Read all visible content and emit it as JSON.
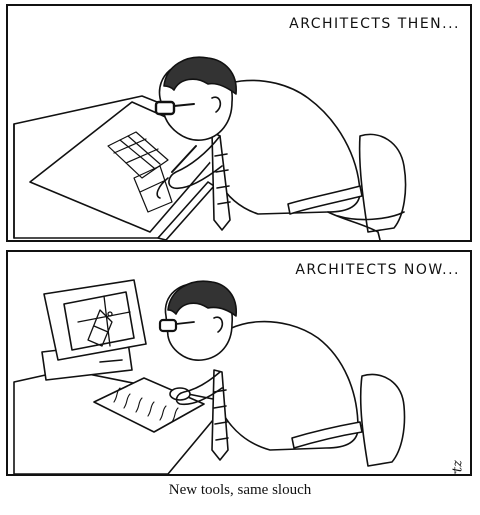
{
  "panels": [
    {
      "label": "ARCHITECTS THEN..."
    },
    {
      "label": "ARCHITECTS NOW..."
    }
  ],
  "caption": "New tools, same slouch",
  "signature": "Schwartz"
}
